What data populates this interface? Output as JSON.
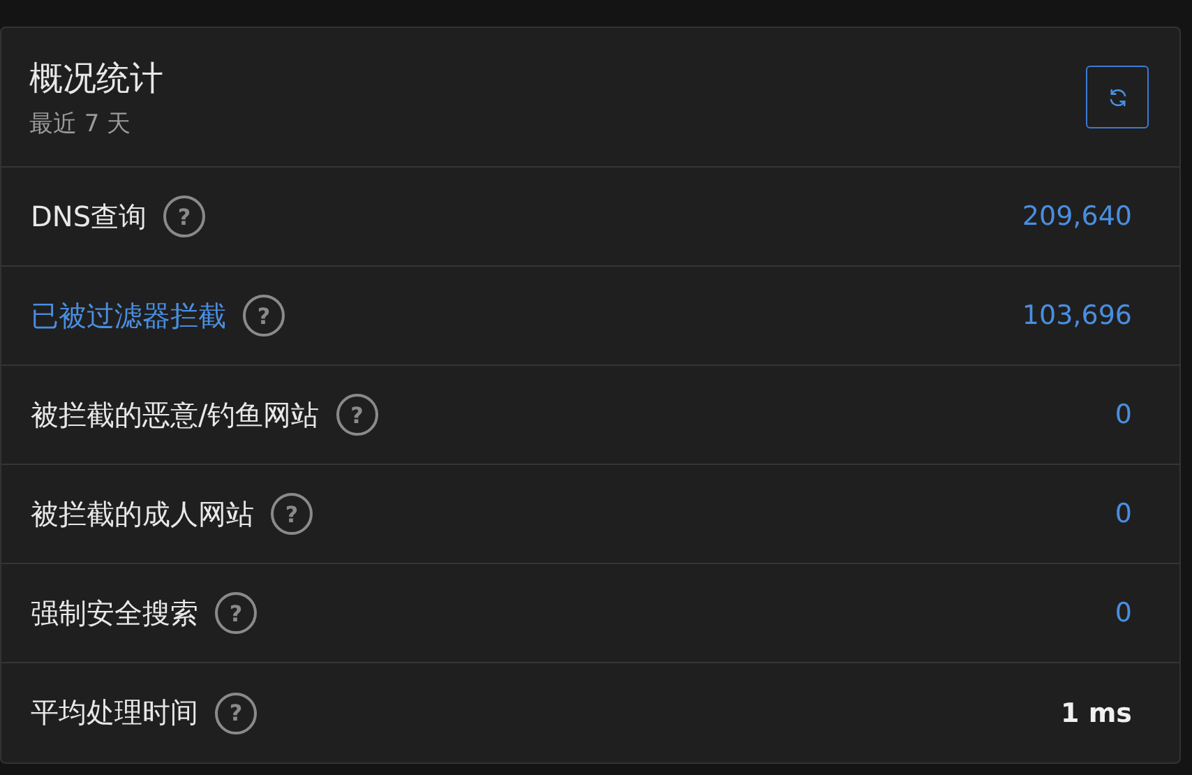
{
  "card": {
    "title": "概况统计",
    "subtitle": "最近 7 天"
  },
  "rows": [
    {
      "label": "DNS查询",
      "link": false,
      "kind": "count",
      "value": "209,640",
      "help": "?"
    },
    {
      "label": "已被过滤器拦截",
      "link": true,
      "kind": "count",
      "value": "103,696",
      "help": "?"
    },
    {
      "label": "被拦截的恶意/钓鱼网站",
      "link": false,
      "kind": "count",
      "value": "0",
      "help": "?"
    },
    {
      "label": "被拦截的成人网站",
      "link": false,
      "kind": "count",
      "value": "0",
      "help": "?"
    },
    {
      "label": "强制安全搜索",
      "link": false,
      "kind": "count",
      "value": "0",
      "help": "?"
    },
    {
      "label": "平均处理时间",
      "link": false,
      "kind": "time",
      "value": "1 ms",
      "help": "?"
    }
  ]
}
